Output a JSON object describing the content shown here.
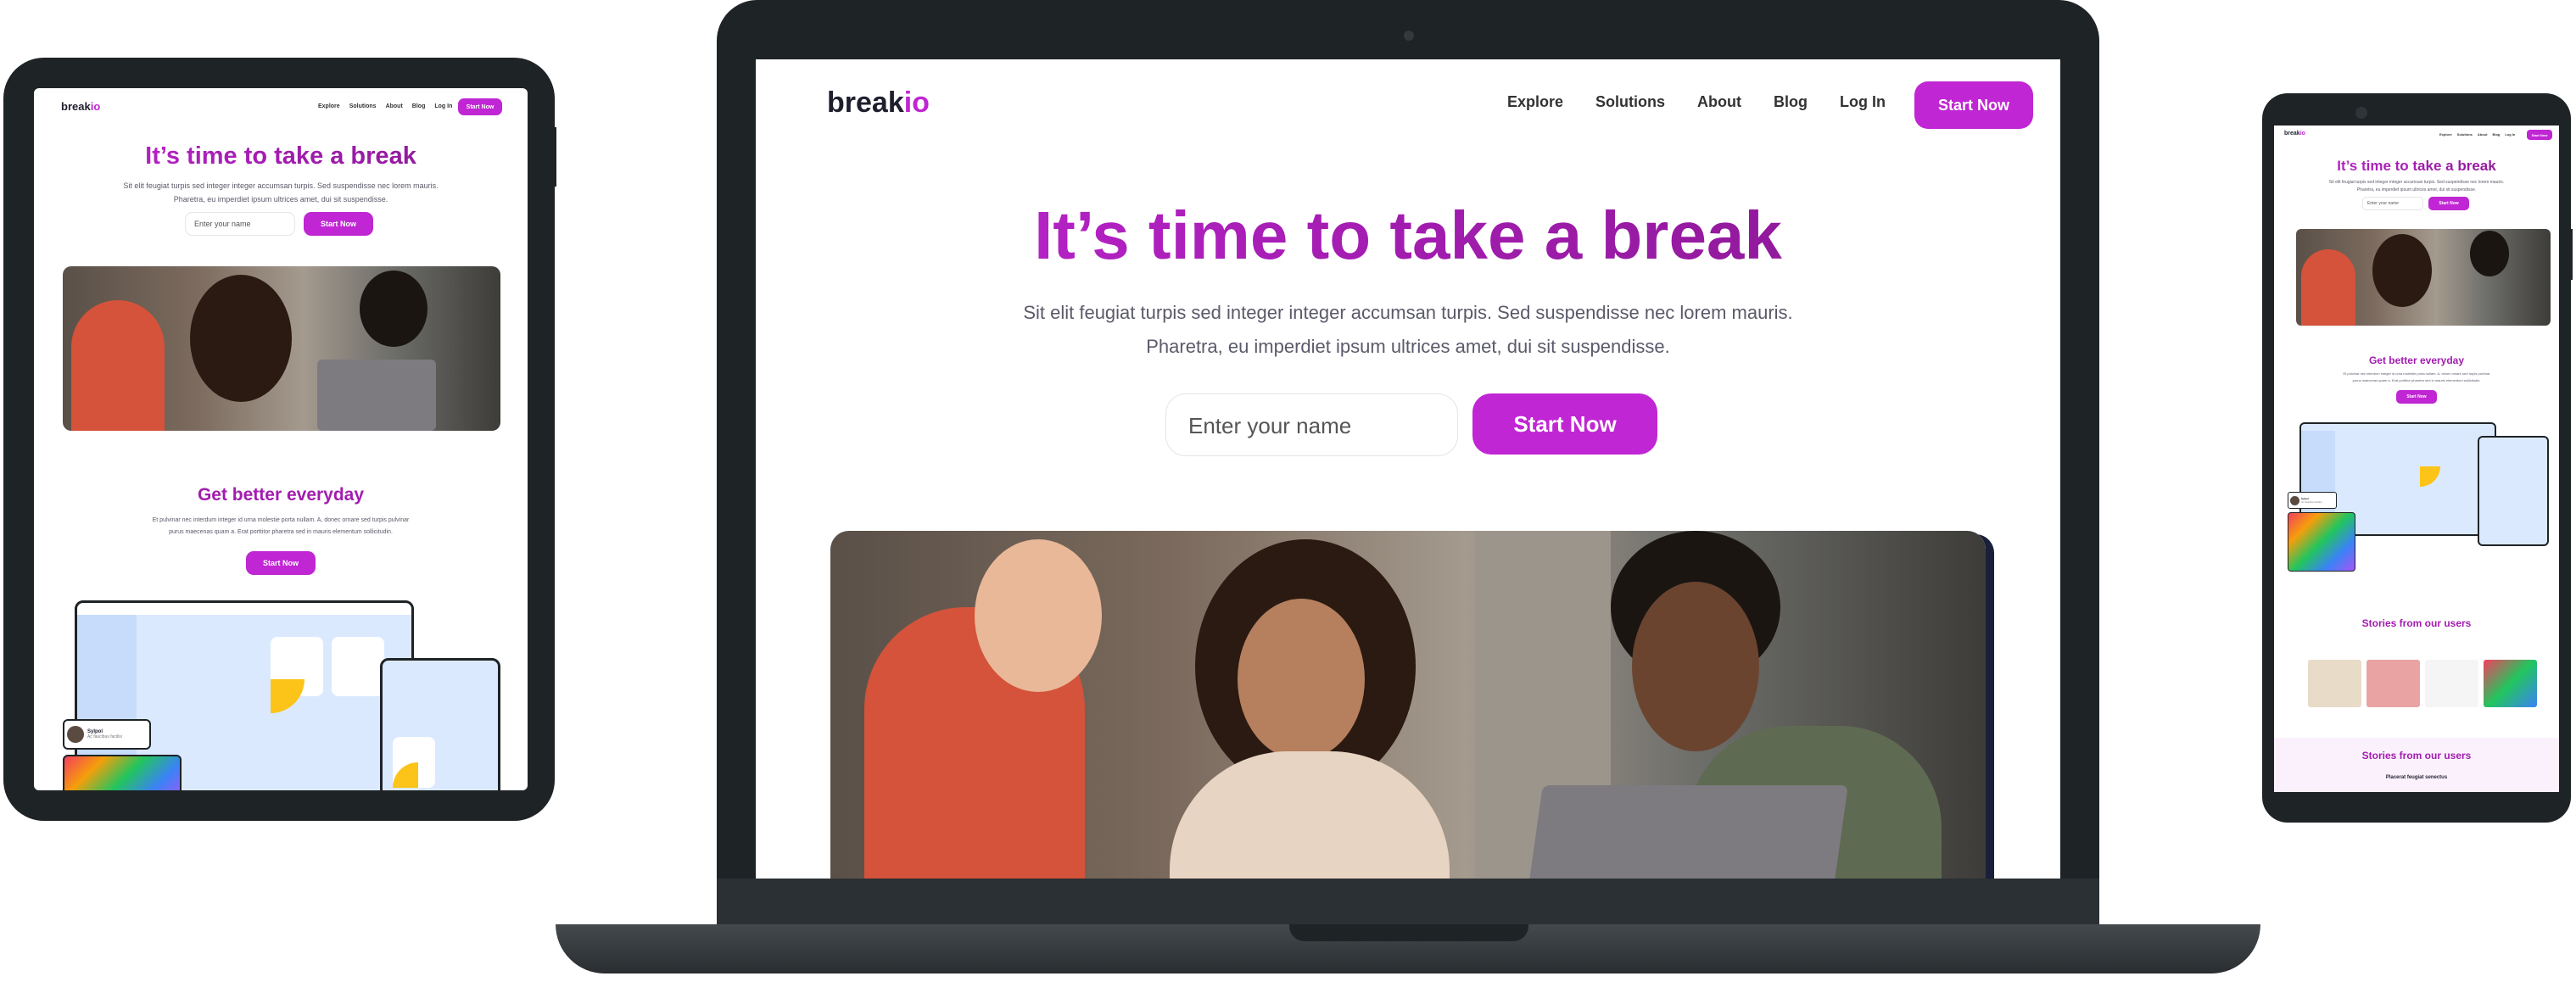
{
  "brand": {
    "logo_main": "break",
    "logo_accent": "io"
  },
  "nav": {
    "items": [
      "Explore",
      "Solutions",
      "About",
      "Blog",
      "Log In"
    ],
    "cta": "Start Now"
  },
  "hero": {
    "title": "It’s time to take a break",
    "desc_line1": "Sit elit feugiat turpis sed integer integer accumsan turpis. Sed suspendisse nec lorem mauris.",
    "desc_line2": "Pharetra, eu imperdiet ipsum ultrices amet, dui sit suspendisse.",
    "input_placeholder": "Enter your name",
    "cta": "Start Now"
  },
  "section_better": {
    "title": "Get better everyday",
    "desc_line1": "Et pulvinar nec interdum integer id urna molestie porta nullam. A, donec ornare sed turpis pulvinar",
    "desc_line2": "purus maecenas quam a. Erat porttitor pharetra sed in mauris elementum sollicitudin.",
    "cta": "Start Now"
  },
  "stories": {
    "title": "Stories from our users"
  },
  "stories_footer": {
    "title": "Stories from our users",
    "subtitle": "Placerat feugiat senectus"
  },
  "profile_card": {
    "name": "Sylpol",
    "subtitle": "Ac faucibus facilisi"
  },
  "colors": {
    "accent": "#c026d3",
    "accent_dark": "#86198f",
    "device_frame": "#1e2326",
    "illustration_bg": "#dbe9ff"
  }
}
